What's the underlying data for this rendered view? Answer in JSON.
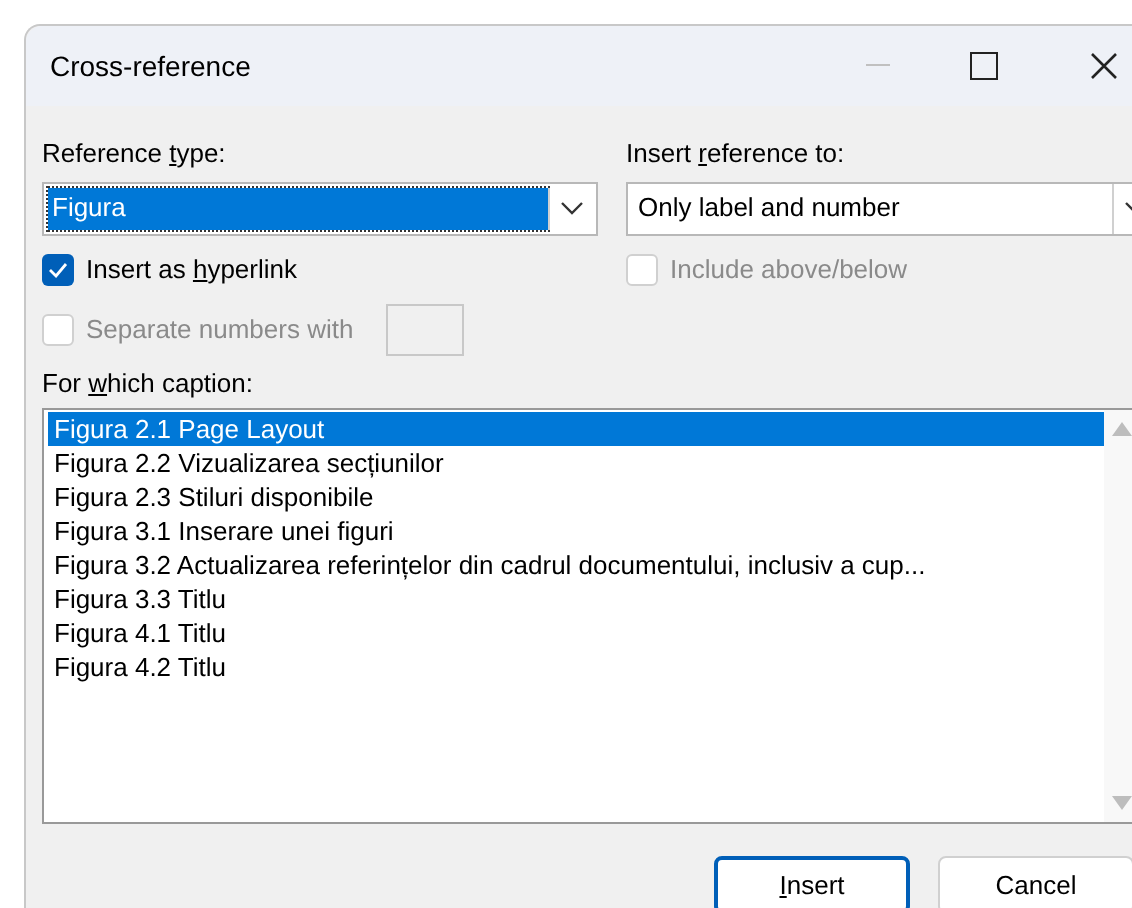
{
  "window": {
    "title": "Cross-reference"
  },
  "reference_type": {
    "label": {
      "before": "Reference ",
      "key": "t",
      "after": "ype:"
    },
    "value": "Figura",
    "selected": true
  },
  "insert_reference_to": {
    "label": {
      "before": "Insert ",
      "key": "r",
      "after": "eference to:"
    },
    "value": "Only label and number"
  },
  "insert_as_hyperlink": {
    "label": {
      "before": "Insert as ",
      "key": "h",
      "after": "yperlink"
    },
    "checked": true,
    "disabled": false
  },
  "include_above_below": {
    "label": {
      "before": "Include above/below"
    },
    "checked": false,
    "disabled": true
  },
  "separate_numbers": {
    "label": {
      "before": "Separate numbers with"
    },
    "checked": false,
    "disabled": true
  },
  "captions": {
    "label": {
      "before": "For ",
      "key": "w",
      "after": "hich caption:"
    },
    "items": [
      {
        "text": "Figura 2.1 Page Layout",
        "selected": true
      },
      {
        "text": "Figura 2.2 Vizualizarea secțiunilor",
        "selected": false
      },
      {
        "text": "Figura 2.3 Stiluri disponibile",
        "selected": false
      },
      {
        "text": "Figura 3.1 Inserare unei figuri",
        "selected": false
      },
      {
        "text": "Figura 3.2 Actualizarea referințelor din cadrul documentului, inclusiv a cup...",
        "selected": false
      },
      {
        "text": "Figura 3.3 Titlu",
        "selected": false
      },
      {
        "text": "Figura 4.1 Titlu",
        "selected": false
      },
      {
        "text": "Figura 4.2 Titlu",
        "selected": false
      }
    ]
  },
  "buttons": [
    {
      "label": {
        "key": "I",
        "after": "nsert"
      },
      "default": true
    },
    {
      "label": {
        "before": "Cancel"
      },
      "default": false
    }
  ]
}
